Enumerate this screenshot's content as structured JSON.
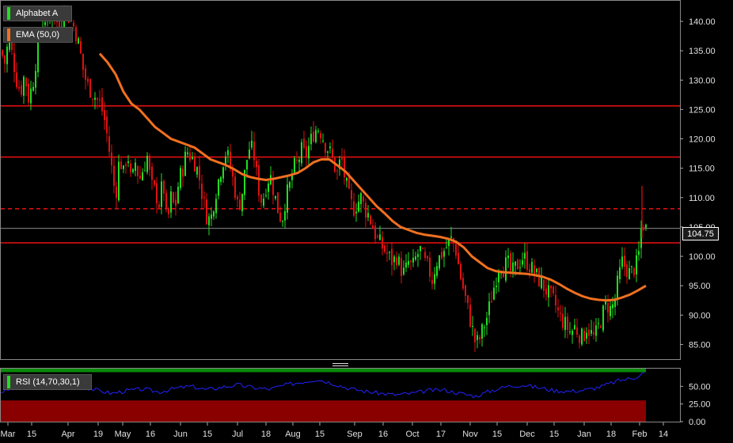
{
  "legend": {
    "instrument": "Alphabet A",
    "ema": "EMA (50,0)",
    "rsi": "RSI (14,70,30,1)"
  },
  "colors": {
    "background": "#000000",
    "up": "#22dd22",
    "down": "#dd1111",
    "ema": "#f07020",
    "support_resistance": "#ee1111",
    "rsi_line": "#2222ff",
    "rsi_overbought_zone": "#0a8a0a",
    "rsi_oversold_zone": "#8a0000"
  },
  "last_price_label": "104.75",
  "chart_data": [
    {
      "type": "candlestick",
      "title": "Alphabet A",
      "ylim": [
        82.5,
        143.5
      ],
      "y_ticks": [
        "140.00",
        "135.00",
        "130.00",
        "125.00",
        "120.00",
        "115.00",
        "110.00",
        "105.00",
        "100.00",
        "95.00",
        "90.00",
        "85.00"
      ],
      "x_tick_labels": [
        "Mar",
        "15",
        "Apr",
        "19",
        "May",
        "16",
        "Jun",
        "15",
        "Jul",
        "18",
        "Aug",
        "15",
        "Sep",
        "16",
        "Oct",
        "17",
        "Nov",
        "15",
        "Dec",
        "15",
        "Jan",
        "18",
        "Feb",
        "14"
      ],
      "horizontal_lines": [
        {
          "value": 125.6,
          "style": "solid"
        },
        {
          "value": 116.9,
          "style": "solid"
        },
        {
          "value": 108.1,
          "style": "dashed"
        },
        {
          "value": 102.3,
          "style": "solid"
        }
      ],
      "last_price": 104.75,
      "close_path": [
        [
          0,
          135
        ],
        [
          5,
          133
        ],
        [
          10,
          137
        ],
        [
          15,
          134
        ],
        [
          20,
          130
        ],
        [
          25,
          128
        ],
        [
          30,
          131
        ],
        [
          35,
          127
        ],
        [
          40,
          129
        ],
        [
          45,
          134
        ],
        [
          50,
          138
        ],
        [
          55,
          141
        ],
        [
          60,
          139
        ],
        [
          65,
          142
        ],
        [
          70,
          140
        ],
        [
          75,
          138
        ],
        [
          80,
          143
        ],
        [
          85,
          141
        ],
        [
          90,
          140
        ],
        [
          95,
          138
        ],
        [
          100,
          135
        ],
        [
          105,
          131
        ],
        [
          110,
          129
        ],
        [
          115,
          128
        ],
        [
          120,
          127
        ],
        [
          125,
          126
        ],
        [
          130,
          124
        ],
        [
          135,
          120
        ],
        [
          140,
          115
        ],
        [
          145,
          110
        ],
        [
          150,
          117
        ],
        [
          155,
          114
        ],
        [
          160,
          118
        ],
        [
          165,
          112
        ],
        [
          170,
          116
        ],
        [
          175,
          113
        ],
        [
          180,
          115
        ],
        [
          185,
          117
        ],
        [
          190,
          112
        ],
        [
          195,
          111
        ],
        [
          200,
          109
        ],
        [
          205,
          113
        ],
        [
          210,
          105
        ],
        [
          215,
          110
        ],
        [
          220,
          108
        ],
        [
          225,
          113
        ],
        [
          230,
          115
        ],
        [
          235,
          118
        ],
        [
          240,
          117
        ],
        [
          245,
          116
        ],
        [
          250,
          114
        ],
        [
          255,
          110
        ],
        [
          260,
          107
        ],
        [
          265,
          106
        ],
        [
          270,
          110
        ],
        [
          275,
          113
        ],
        [
          280,
          116
        ],
        [
          285,
          118
        ],
        [
          290,
          115
        ],
        [
          295,
          112
        ],
        [
          300,
          108
        ],
        [
          305,
          111
        ],
        [
          310,
          116
        ],
        [
          315,
          119
        ],
        [
          320,
          117
        ],
        [
          325,
          112
        ],
        [
          330,
          109
        ],
        [
          335,
          112
        ],
        [
          340,
          114
        ],
        [
          345,
          111
        ],
        [
          350,
          108
        ],
        [
          355,
          106
        ],
        [
          360,
          110
        ],
        [
          365,
          112
        ],
        [
          370,
          115
        ],
        [
          375,
          116
        ],
        [
          380,
          118
        ],
        [
          385,
          117
        ],
        [
          390,
          119
        ],
        [
          395,
          121
        ],
        [
          400,
          122
        ],
        [
          405,
          121
        ],
        [
          410,
          119
        ],
        [
          415,
          118
        ],
        [
          420,
          116
        ],
        [
          425,
          114
        ],
        [
          430,
          117
        ],
        [
          435,
          113
        ],
        [
          440,
          110
        ],
        [
          445,
          108
        ],
        [
          450,
          109
        ],
        [
          455,
          110
        ],
        [
          460,
          108
        ],
        [
          465,
          107
        ],
        [
          470,
          105
        ],
        [
          475,
          103
        ],
        [
          480,
          102
        ],
        [
          485,
          101
        ],
        [
          490,
          100
        ],
        [
          495,
          99
        ],
        [
          500,
          100
        ],
        [
          505,
          98
        ],
        [
          510,
          97
        ],
        [
          515,
          99
        ],
        [
          520,
          98
        ],
        [
          525,
          100
        ],
        [
          530,
          101
        ],
        [
          535,
          99
        ],
        [
          540,
          98
        ],
        [
          545,
          96
        ],
        [
          550,
          99
        ],
        [
          555,
          100
        ],
        [
          560,
          101
        ],
        [
          565,
          102
        ],
        [
          570,
          103
        ],
        [
          575,
          101
        ],
        [
          580,
          97
        ],
        [
          585,
          94
        ],
        [
          590,
          91
        ],
        [
          595,
          88
        ],
        [
          600,
          85
        ],
        [
          605,
          86
        ],
        [
          610,
          88
        ],
        [
          615,
          90
        ],
        [
          620,
          93
        ],
        [
          625,
          96
        ],
        [
          630,
          99
        ],
        [
          635,
          98
        ],
        [
          640,
          99
        ],
        [
          645,
          97
        ],
        [
          650,
          98
        ],
        [
          655,
          99
        ],
        [
          660,
          100
        ],
        [
          665,
          99
        ],
        [
          670,
          98
        ],
        [
          675,
          97
        ],
        [
          680,
          96
        ],
        [
          685,
          95
        ],
        [
          690,
          94
        ],
        [
          695,
          93
        ],
        [
          700,
          92
        ],
        [
          705,
          90
        ],
        [
          710,
          89
        ],
        [
          715,
          88
        ],
        [
          720,
          87
        ],
        [
          725,
          88
        ],
        [
          730,
          87
        ],
        [
          735,
          86
        ],
        [
          740,
          88
        ],
        [
          745,
          87
        ],
        [
          750,
          86
        ],
        [
          755,
          88
        ],
        [
          760,
          90
        ],
        [
          765,
          92
        ],
        [
          770,
          91
        ],
        [
          775,
          92
        ],
        [
          780,
          96
        ],
        [
          785,
          99
        ],
        [
          790,
          98
        ],
        [
          795,
          97
        ],
        [
          800,
          98
        ],
        [
          805,
          99
        ],
        [
          810,
          106
        ],
        [
          815,
          104.75
        ]
      ],
      "ema_path": [
        [
          125,
          134.5
        ],
        [
          135,
          133
        ],
        [
          145,
          131
        ],
        [
          155,
          128
        ],
        [
          165,
          126
        ],
        [
          175,
          125
        ],
        [
          185,
          123.5
        ],
        [
          195,
          122
        ],
        [
          205,
          121
        ],
        [
          215,
          120
        ],
        [
          225,
          119.5
        ],
        [
          235,
          119
        ],
        [
          245,
          118.5
        ],
        [
          255,
          117.5
        ],
        [
          265,
          116.5
        ],
        [
          275,
          116
        ],
        [
          285,
          115.5
        ],
        [
          295,
          114.8
        ],
        [
          305,
          114
        ],
        [
          315,
          113.5
        ],
        [
          325,
          113.2
        ],
        [
          335,
          113
        ],
        [
          345,
          113.2
        ],
        [
          355,
          113.5
        ],
        [
          365,
          113.8
        ],
        [
          375,
          114.2
        ],
        [
          385,
          115
        ],
        [
          395,
          116
        ],
        [
          405,
          116.5
        ],
        [
          415,
          116.5
        ],
        [
          425,
          115.5
        ],
        [
          435,
          114.5
        ],
        [
          445,
          113
        ],
        [
          455,
          111.5
        ],
        [
          465,
          110
        ],
        [
          475,
          108.5
        ],
        [
          485,
          107.3
        ],
        [
          495,
          106
        ],
        [
          505,
          105
        ],
        [
          515,
          104.5
        ],
        [
          525,
          104
        ],
        [
          535,
          103.7
        ],
        [
          545,
          103.5
        ],
        [
          555,
          103.3
        ],
        [
          565,
          103
        ],
        [
          575,
          102.5
        ],
        [
          585,
          101.5
        ],
        [
          595,
          100
        ],
        [
          605,
          99
        ],
        [
          615,
          98
        ],
        [
          625,
          97.5
        ],
        [
          635,
          97.3
        ],
        [
          645,
          97.2
        ],
        [
          655,
          97.1
        ],
        [
          665,
          97
        ],
        [
          675,
          96.8
        ],
        [
          685,
          96.5
        ],
        [
          695,
          96
        ],
        [
          705,
          95.3
        ],
        [
          715,
          94.5
        ],
        [
          725,
          93.8
        ],
        [
          735,
          93.2
        ],
        [
          745,
          92.8
        ],
        [
          755,
          92.6
        ],
        [
          765,
          92.5
        ],
        [
          775,
          92.6
        ],
        [
          785,
          93
        ],
        [
          795,
          93.5
        ],
        [
          805,
          94.2
        ],
        [
          815,
          95
        ]
      ]
    },
    {
      "type": "line",
      "title": "RSI (14,70,30,1)",
      "ylim": [
        0,
        75
      ],
      "y_ticks": [
        "50.00",
        "25.00",
        "0.00"
      ],
      "zones": {
        "overbought": 70,
        "oversold": 30
      },
      "path": [
        [
          0,
          42
        ],
        [
          20,
          48
        ],
        [
          40,
          52
        ],
        [
          60,
          56
        ],
        [
          80,
          55
        ],
        [
          100,
          50
        ],
        [
          120,
          45
        ],
        [
          140,
          40
        ],
        [
          160,
          44
        ],
        [
          180,
          46
        ],
        [
          200,
          42
        ],
        [
          220,
          47
        ],
        [
          240,
          50
        ],
        [
          260,
          45
        ],
        [
          280,
          49
        ],
        [
          300,
          52
        ],
        [
          320,
          48
        ],
        [
          340,
          46
        ],
        [
          360,
          52
        ],
        [
          380,
          56
        ],
        [
          400,
          60
        ],
        [
          420,
          54
        ],
        [
          440,
          47
        ],
        [
          460,
          43
        ],
        [
          480,
          40
        ],
        [
          500,
          38
        ],
        [
          520,
          40
        ],
        [
          540,
          44
        ],
        [
          560,
          45
        ],
        [
          580,
          40
        ],
        [
          600,
          36
        ],
        [
          620,
          44
        ],
        [
          640,
          50
        ],
        [
          660,
          52
        ],
        [
          680,
          48
        ],
        [
          700,
          44
        ],
        [
          720,
          43
        ],
        [
          740,
          45
        ],
        [
          760,
          50
        ],
        [
          780,
          58
        ],
        [
          800,
          62
        ],
        [
          810,
          68
        ],
        [
          815,
          70
        ]
      ]
    }
  ]
}
